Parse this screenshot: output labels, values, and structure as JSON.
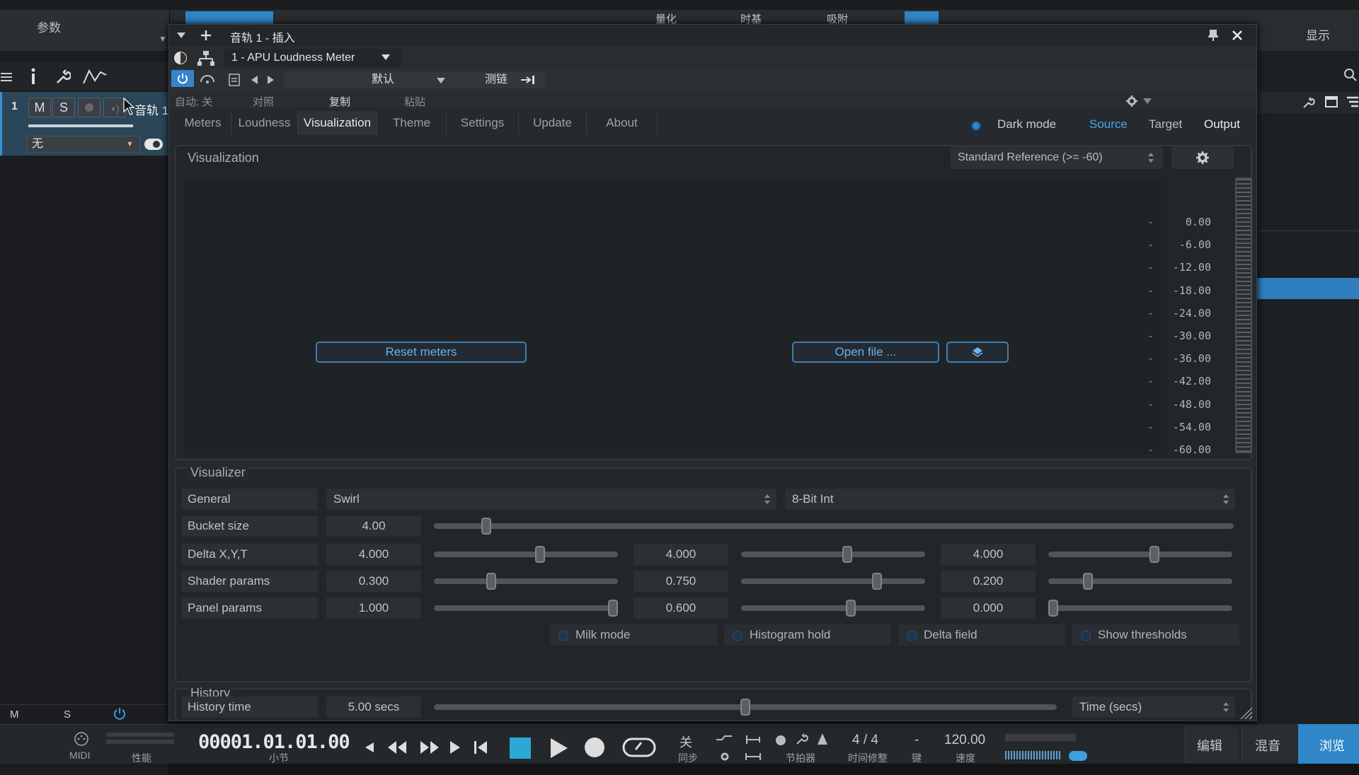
{
  "host": {
    "params_label": "参数",
    "top_tabs": [
      "量化",
      "时基",
      "吸附"
    ],
    "display_label": "显示",
    "track": {
      "number": "1",
      "mute": "M",
      "solo": "S",
      "name": "音轨 1",
      "input": "无"
    },
    "left_bottom": {
      "m": "M",
      "s": "S"
    },
    "transport": {
      "midi": "MIDI",
      "perf": "性能",
      "timecode": "00001.01.01.00",
      "timecode_unit": "小节",
      "sync_value": "关",
      "sync_label": "同步",
      "metronome": "节拍器",
      "timesig": "4 / 4",
      "timesig_label": "时间修整",
      "key": "-",
      "key_label": "键",
      "tempo": "120.00",
      "tempo_label": "速度",
      "tab_edit": "编辑",
      "tab_mix": "混音",
      "tab_browse": "浏览"
    }
  },
  "plugin": {
    "title": "音轨 1 - 插入",
    "name": "1 - APU Loudness Meter",
    "preset": "默认",
    "sidechain": "测链",
    "auto": "自动: 关",
    "compare": "对照",
    "copy": "复制",
    "paste": "粘贴",
    "tabs": [
      "Meters",
      "Loudness",
      "Visualization",
      "Theme",
      "Settings",
      "Update",
      "About"
    ],
    "active_tab": "Visualization",
    "dark_mode": "Dark mode",
    "links": {
      "source": "Source",
      "target": "Target",
      "output": "Output"
    },
    "accent_color": "#2f86c8",
    "visualization": {
      "title": "Visualization",
      "reference": "Standard Reference (>= -60)",
      "scale": [
        "0.00",
        "-6.00",
        "-12.00",
        "-18.00",
        "-24.00",
        "-30.00",
        "-36.00",
        "-42.00",
        "-48.00",
        "-54.00",
        "-60.00"
      ],
      "scale_dash": "-",
      "reset": "Reset meters",
      "open": "Open file ..."
    },
    "visualizer": {
      "title": "Visualizer",
      "general_label": "General",
      "general_mode": "Swirl",
      "general_format": "8-Bit Int",
      "bucket_label": "Bucket size",
      "bucket_value": "4.00",
      "bucket_level": 0.06,
      "delta_label": "Delta X,Y,T",
      "delta": [
        {
          "value": "4.000",
          "level": 0.58
        },
        {
          "value": "4.000",
          "level": 0.58
        },
        {
          "value": "4.000",
          "level": 0.58
        }
      ],
      "shader_label": "Shader params",
      "shader": [
        {
          "value": "0.300",
          "level": 0.3
        },
        {
          "value": "0.750",
          "level": 0.75
        },
        {
          "value": "0.200",
          "level": 0.2
        }
      ],
      "panel_label": "Panel params",
      "panel": [
        {
          "value": "1.000",
          "level": 1.0
        },
        {
          "value": "0.600",
          "level": 0.6
        },
        {
          "value": "0.000",
          "level": 0.0
        }
      ],
      "options": [
        "Milk mode",
        "Histogram hold",
        "Delta field",
        "Show thresholds"
      ]
    },
    "history": {
      "title": "History",
      "label": "History time",
      "value": "5.00 secs",
      "level": 0.5,
      "unit": "Time (secs)"
    }
  }
}
